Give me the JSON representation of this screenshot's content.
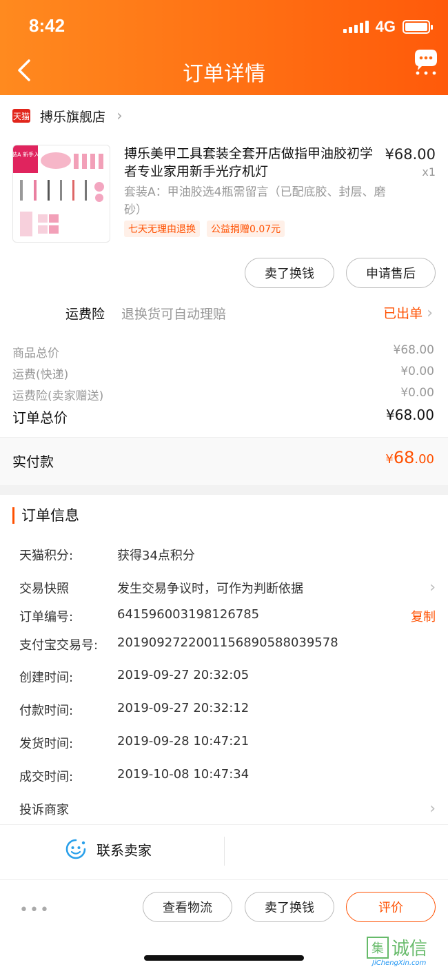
{
  "status_bar": {
    "time": "8:42",
    "network": "4G"
  },
  "header": {
    "title": "订单详情"
  },
  "store": {
    "icon_text": "天猫",
    "name": "搏乐旗舰店"
  },
  "product": {
    "title": "搏乐美甲工具套装全套开店做指甲油胶初学者专业家用新手光疗机灯",
    "price": "¥68.00",
    "qty": "x1",
    "sku": "套装A：甲油胶选4瓶需留言（已配底胶、封层、磨砂）",
    "tags": [
      "七天无理由退换",
      "公益捐赠0.07元"
    ],
    "image_label": "套装A 新手入门"
  },
  "actions": {
    "sell_label": "卖了换钱",
    "after_sale_label": "申请售后"
  },
  "freight_insurance": {
    "label": "运费险",
    "desc": "退换货可自动理赔",
    "status": "已出单"
  },
  "prices": [
    {
      "label": "商品总价",
      "value": "¥68.00"
    },
    {
      "label": "运费(快递)",
      "value": "¥0.00"
    },
    {
      "label": "运费险(卖家赠送)",
      "value": "¥0.00"
    }
  ],
  "order_total": {
    "label": "订单总价",
    "value": "¥68.00"
  },
  "paid": {
    "label": "实付款",
    "currency": "¥",
    "integer": "68",
    "decimal": ".00"
  },
  "order_info": {
    "title": "订单信息",
    "rows": [
      {
        "key": "天猫积分:",
        "value": "获得34点积分"
      },
      {
        "key": "交易快照",
        "value": "发生交易争议时，可作为判断依据"
      },
      {
        "key": "订单编号:",
        "value": "641596003198126785",
        "action": "复制"
      },
      {
        "key": "支付宝交易号:",
        "value": "2019092722001156890588039578"
      },
      {
        "key": "创建时间:",
        "value": "2019-09-27 20:32:05"
      },
      {
        "key": "付款时间:",
        "value": "2019-09-27 20:32:12"
      },
      {
        "key": "发货时间:",
        "value": "2019-09-28 10:47:21"
      },
      {
        "key": "成交时间:",
        "value": "2019-10-08 10:47:34"
      },
      {
        "key": "投诉商家",
        "value": ""
      }
    ]
  },
  "contact": {
    "label": "联系卖家"
  },
  "bottom": {
    "more": "•••",
    "logistics": "查看物流",
    "sell": "卖了换钱",
    "review": "评价"
  },
  "watermark": {
    "text": "诚信",
    "sub": "JiChengXin.com"
  },
  "colors": {
    "accent": "#ff5000",
    "header_start": "#ff8a1f",
    "header_end": "#ff5a0a"
  }
}
